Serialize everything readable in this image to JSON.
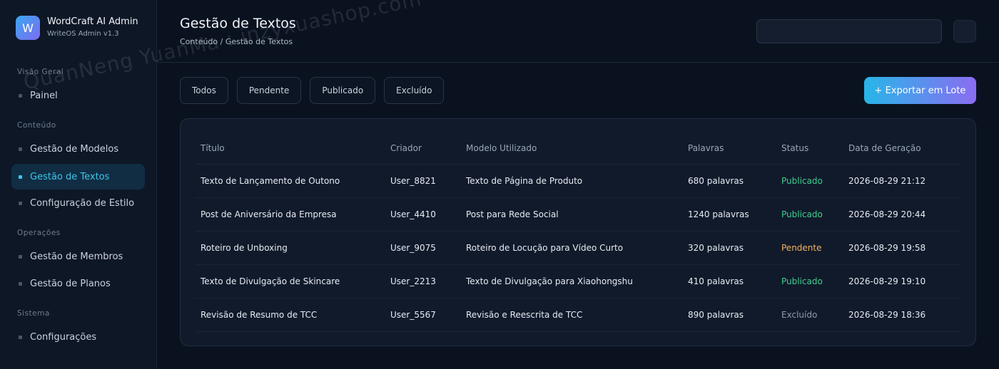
{
  "brand": {
    "logo_letter": "W",
    "name": "WordCraft AI Admin",
    "version": "WriteOS Admin v1.3"
  },
  "sidebar": {
    "sections": [
      {
        "title": "Visão Geral",
        "items": [
          {
            "label": "Painel",
            "active": false
          }
        ]
      },
      {
        "title": "Conteúdo",
        "items": [
          {
            "label": "Gestão de Modelos",
            "active": false
          },
          {
            "label": "Gestão de Textos",
            "active": true
          },
          {
            "label": "Configuração de Estilo",
            "active": false
          }
        ]
      },
      {
        "title": "Operações",
        "items": [
          {
            "label": "Gestão de Membros",
            "active": false
          },
          {
            "label": "Gestão de Planos",
            "active": false
          }
        ]
      },
      {
        "title": "Sistema",
        "items": [
          {
            "label": "Configurações",
            "active": false
          }
        ]
      }
    ]
  },
  "header": {
    "title": "Gestão de Textos",
    "breadcrumb": "Conteúdo / Gestão de Textos",
    "search_value": ""
  },
  "filters": [
    "Todos",
    "Pendente",
    "Publicado",
    "Excluído"
  ],
  "export_label": "+ Exportar em Lote",
  "table": {
    "columns": [
      "Título",
      "Criador",
      "Modelo Utilizado",
      "Palavras",
      "Status",
      "Data de Geração"
    ],
    "rows": [
      [
        "Texto de Lançamento de Outono",
        "User_8821",
        "Texto de Página de Produto",
        "680 palavras",
        "Publicado",
        "2026-08-29 21:12"
      ],
      [
        "Post de Aniversário da Empresa",
        "User_4410",
        "Post para Rede Social",
        "1240 palavras",
        "Publicado",
        "2026-08-29 20:44"
      ],
      [
        "Roteiro de Unboxing",
        "User_9075",
        "Roteiro de Locução para Vídeo Curto",
        "320 palavras",
        "Pendente",
        "2026-08-29 19:58"
      ],
      [
        "Texto de Divulgação de Skincare",
        "User_2213",
        "Texto de Divulgação para Xiaohongshu",
        "410 palavras",
        "Publicado",
        "2026-08-29 19:10"
      ],
      [
        "Revisão de Resumo de TCC",
        "User_5567",
        "Revisão e Reescrita de TCC",
        "890 palavras",
        "Excluído",
        "2026-08-29 18:36"
      ]
    ]
  },
  "status_colors": {
    "Publicado": "#3fcf8e",
    "Pendente": "#f0b45c",
    "Excluído": "#8f9aab"
  },
  "accent_color": "#3cc6e8",
  "watermark": "QuanNeng YuanMa : inzyxuashop.com"
}
